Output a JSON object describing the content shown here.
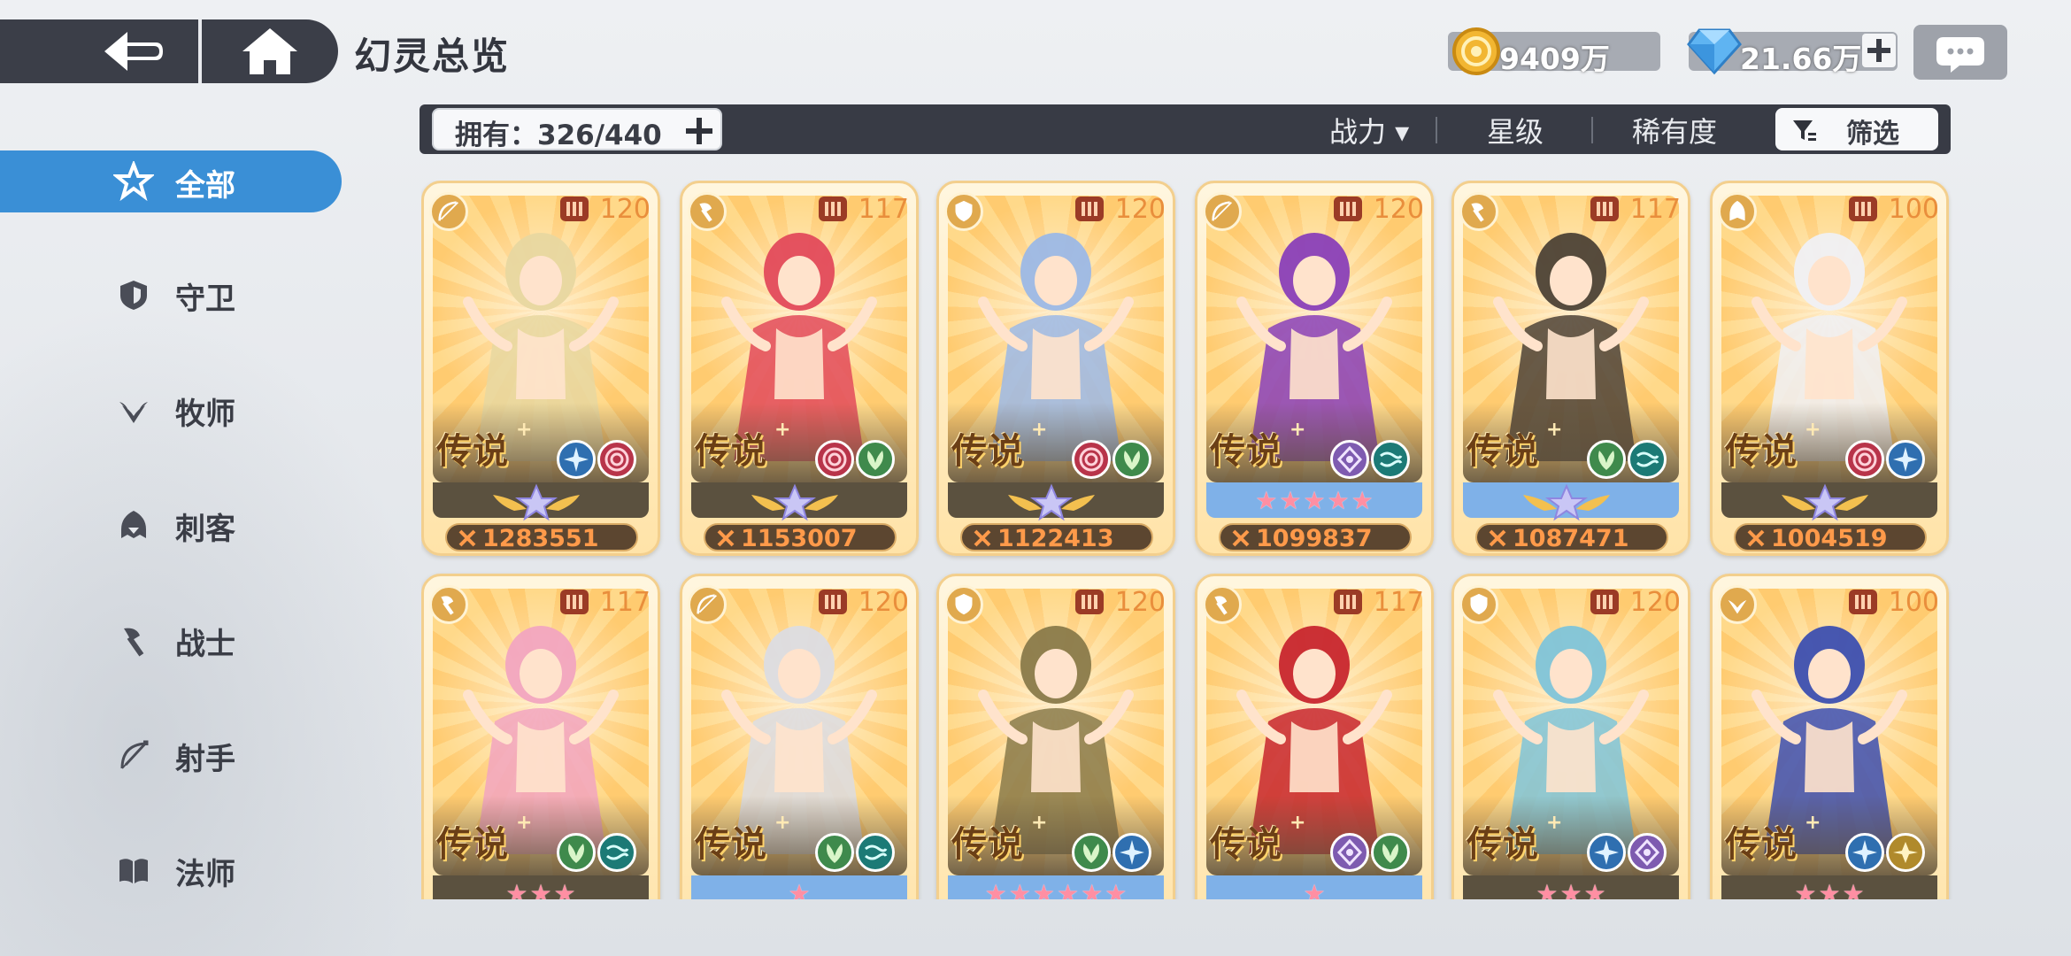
{
  "header": {
    "title": "幻灵总览",
    "back_icon": "back-arrow-icon",
    "home_icon": "home-icon",
    "gold": "9409万",
    "gems": "21.66万",
    "chat_icon": "chat-bubble-icon"
  },
  "filter_bar": {
    "owned_label": "拥有：326/440",
    "sort_options": [
      "战力 ▾",
      "星级",
      "稀有度"
    ],
    "screen_label": "筛选"
  },
  "sidebar": {
    "items": [
      {
        "label": "全部",
        "icon": "all-star-icon",
        "active": true
      },
      {
        "label": "守卫",
        "icon": "shield-icon",
        "active": false
      },
      {
        "label": "牧师",
        "icon": "priest-wing-icon",
        "active": false
      },
      {
        "label": "刺客",
        "icon": "assassin-hood-icon",
        "active": false
      },
      {
        "label": "战士",
        "icon": "axe-icon",
        "active": false
      },
      {
        "label": "射手",
        "icon": "bow-icon",
        "active": false
      },
      {
        "label": "法师",
        "icon": "book-icon",
        "active": false
      }
    ]
  },
  "rarity_label": "传说",
  "cards": [
    {
      "level": "120",
      "class": "archer",
      "elements": [
        "ice",
        "swirl"
      ],
      "band": "emblem",
      "stars": 0,
      "power": "1283551",
      "palette": "#e8d7a0"
    },
    {
      "level": "117",
      "class": "warrior",
      "elements": [
        "swirl",
        "leaf"
      ],
      "band": "emblem",
      "stars": 0,
      "power": "1153007",
      "palette": "#e34a5b"
    },
    {
      "level": "120",
      "class": "guard",
      "elements": [
        "swirl",
        "leaf"
      ],
      "band": "emblem",
      "stars": 0,
      "power": "1122413",
      "palette": "#9cb8e6"
    },
    {
      "level": "120",
      "class": "archer",
      "elements": [
        "void",
        "wind"
      ],
      "band": "stars",
      "stars": 5,
      "power": "1099837",
      "palette": "#8a3fb8"
    },
    {
      "level": "117",
      "class": "warrior",
      "elements": [
        "leaf",
        "wind"
      ],
      "band": "emblem-blue",
      "stars": 0,
      "power": "1087471",
      "palette": "#4d4236"
    },
    {
      "level": "100",
      "class": "assassin",
      "elements": [
        "swirl",
        "ice"
      ],
      "band": "emblem",
      "stars": 0,
      "power": "1004519",
      "palette": "#f0f0f4"
    },
    {
      "level": "117",
      "class": "warrior",
      "elements": [
        "leaf",
        "wind"
      ],
      "band": "stars-dark",
      "stars": 3,
      "power": "",
      "palette": "#f2a5c0"
    },
    {
      "level": "120",
      "class": "archer",
      "elements": [
        "leaf",
        "wind"
      ],
      "band": "stars",
      "stars": 1,
      "power": "",
      "palette": "#dcdce2"
    },
    {
      "level": "120",
      "class": "guard",
      "elements": [
        "leaf",
        "ice"
      ],
      "band": "stars",
      "stars": 6,
      "power": "",
      "palette": "#8a7a4a"
    },
    {
      "level": "117",
      "class": "warrior",
      "elements": [
        "void",
        "leaf"
      ],
      "band": "stars",
      "stars": 1,
      "power": "",
      "palette": "#c8262e"
    },
    {
      "level": "120",
      "class": "guard",
      "elements": [
        "ice",
        "void"
      ],
      "band": "stars-dark",
      "stars": 3,
      "power": "",
      "palette": "#7fc4d9"
    },
    {
      "level": "100",
      "class": "priest",
      "elements": [
        "ice",
        "light"
      ],
      "band": "stars-dark",
      "stars": 3,
      "power": "",
      "palette": "#3d4fb0"
    }
  ],
  "colors": {
    "accent": "#3a8fd6",
    "bar": "#383b45",
    "power_text": "#ff9a4a",
    "level_text": "#e98e3c"
  }
}
